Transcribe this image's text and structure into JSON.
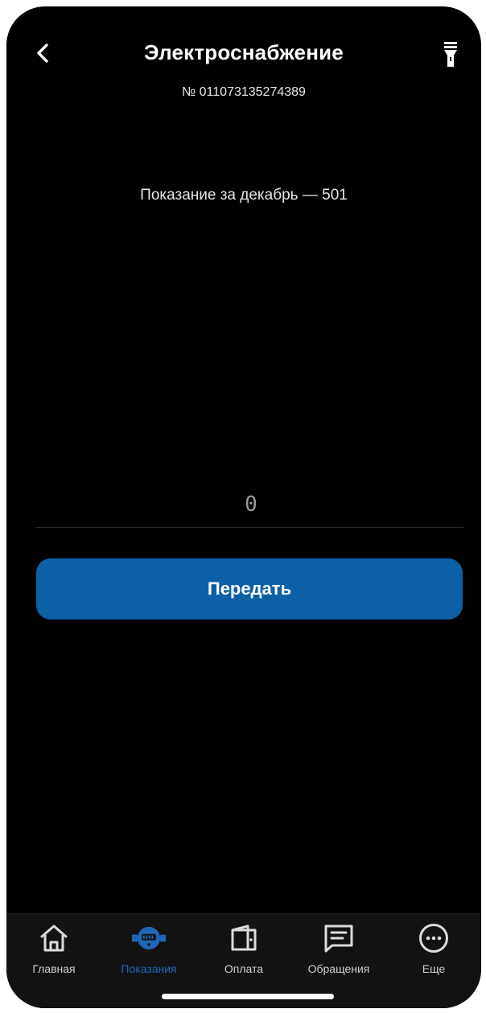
{
  "header": {
    "title": "Электроснабжение",
    "account_number": "№ 011073135274389",
    "back_icon": "chevron-left-icon",
    "flash_icon": "flashlight-icon"
  },
  "reading": {
    "info": "Показание за декабрь — 501",
    "input_value": "0",
    "submit_label": "Передать"
  },
  "tabbar": {
    "items": [
      {
        "label": "Главная",
        "icon": "home-icon",
        "active": false
      },
      {
        "label": "Показания",
        "icon": "meter-icon",
        "active": true
      },
      {
        "label": "Оплата",
        "icon": "wallet-icon",
        "active": false
      },
      {
        "label": "Обращения",
        "icon": "message-icon",
        "active": false
      },
      {
        "label": "Еще",
        "icon": "more-icon",
        "active": false
      }
    ]
  },
  "colors": {
    "background": "#000000",
    "accent": "#0d5fa6",
    "active_tab": "#1f66b5",
    "tabbar_bg": "#121212"
  }
}
